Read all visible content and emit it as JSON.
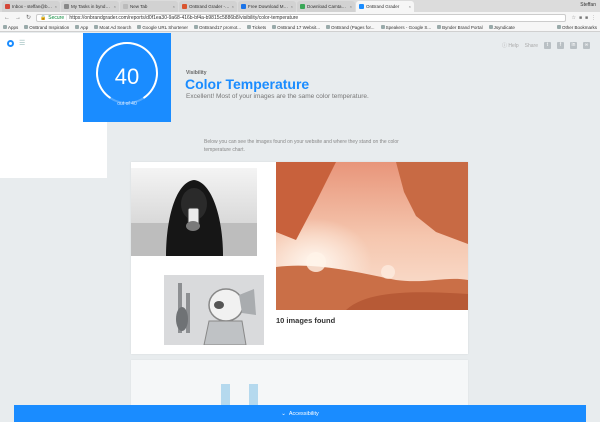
{
  "browser": {
    "tabs": [
      {
        "title": "Inbox - steffan@bynder.com",
        "color": "#d44638",
        "active": false
      },
      {
        "title": "My Tasks in bynder.com - A",
        "color": "#888888",
        "active": false
      },
      {
        "title": "New Tab",
        "color": "#bbbbbb",
        "active": false
      },
      {
        "title": "OnBrand Grader - Product H",
        "color": "#da552f",
        "active": false
      },
      {
        "title": "Free Download Manager - S",
        "color": "#1a73e8",
        "active": false
      },
      {
        "title": "Download Camtasia 2 3.0 C",
        "color": "#3aa757",
        "active": false
      },
      {
        "title": "OnBrand Grader",
        "color": "#1a8cff",
        "active": true
      }
    ],
    "user": "Steffan",
    "url": "https://onbrandgrader.com/reports/d0f1ea30-9a68-416b-bf4a-b9815c5886b8/visibility/color-temperature",
    "secure_label": "Secure",
    "bookmarks": [
      "Apps",
      "OnBrand Inspiration",
      "App",
      "Moat Ad Search",
      "Google URL Shortener",
      "OnBrand17 promot...",
      "Tickets",
      "OnBrand 17 Websit...",
      "OnBrand (Pages for...",
      "Speakers - Google S...",
      "Bynder Brand Portal",
      "Jsyndicate"
    ],
    "other_bookmarks": "Other Bookmarks"
  },
  "header": {
    "help_label": "Help",
    "share_label": "Share",
    "social_icons": [
      "twitter-icon",
      "facebook-icon",
      "linkedin-icon",
      "link-icon"
    ]
  },
  "score": {
    "value": "40",
    "subtitle": "out of 40",
    "fraction": 1.0
  },
  "section": {
    "label": "Visibility",
    "title": "Color Temperature",
    "description": "Excellent! Most of your images are the same color temperature."
  },
  "intro_text": "Below you can see the images found on your website and where they stand on the color temperature chart.",
  "images_card": {
    "found_label": "10 images found"
  },
  "accessibility": {
    "label": "Accessibility",
    "icon": "chevron-down-icon"
  }
}
